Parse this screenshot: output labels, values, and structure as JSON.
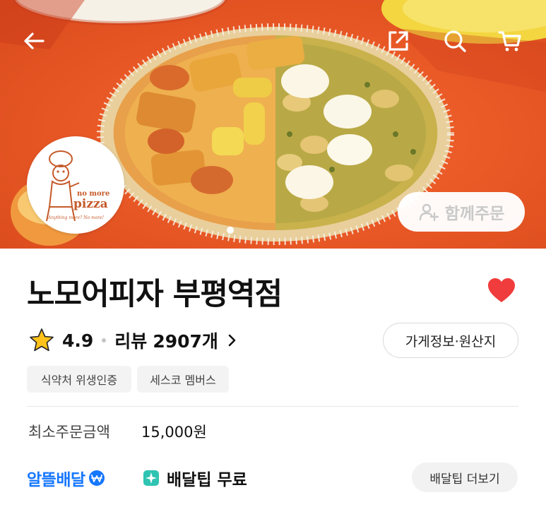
{
  "hero": {
    "together_order_label": "함께주문",
    "logo": {
      "line1": "no more",
      "line2": "pizza",
      "line3": "Anything more? No more!"
    },
    "carousel": {
      "current_index": 1,
      "total_visible": 1
    }
  },
  "store": {
    "name": "노모어피자 부평역점",
    "favorited": true
  },
  "rating": {
    "value": "4.9",
    "review_label": "리뷰",
    "review_count": "2907개"
  },
  "info_button_label": "가게정보·원산지",
  "badges": [
    "식약처 위생인증",
    "세스코 멤버스"
  ],
  "min_order": {
    "label": "최소주문금액",
    "value": "15,000원"
  },
  "delivery": {
    "service_name": "알뜰배달",
    "fee_text": "배달팁 무료",
    "more_label": "배달팁 더보기"
  },
  "icons": {
    "back": "back-arrow-icon",
    "share": "share-icon",
    "search": "search-icon",
    "cart": "cart-icon",
    "star": "star-icon",
    "heart": "heart-icon",
    "person_add": "person-add-icon",
    "chevron": "chevron-right-icon"
  },
  "colors": {
    "heart": "#f03c3c",
    "star": "#ffc21a",
    "alddeul_blue": "#1677ff",
    "fee_icon": "#2fc4b2"
  }
}
